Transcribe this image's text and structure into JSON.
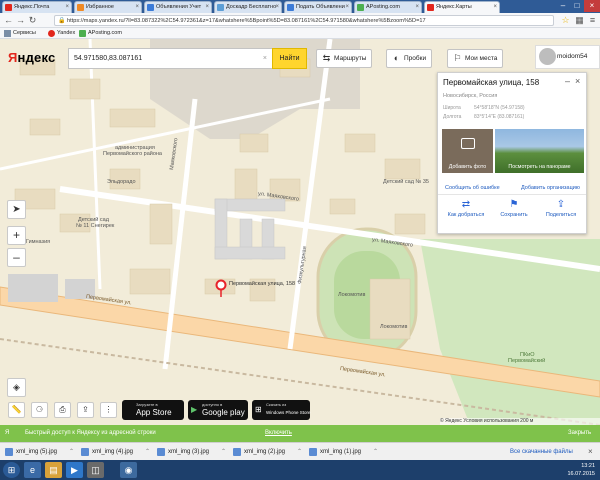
{
  "browser": {
    "tabs": [
      {
        "label": "Яндекс.Почта",
        "color": "#e2261c"
      },
      {
        "label": "Избранное",
        "color": "#f08a24"
      },
      {
        "label": "Объявления Учет",
        "color": "#3b7bd8"
      },
      {
        "label": "Доскадр Бесплатно",
        "color": "#5c9ed6"
      },
      {
        "label": "Подать Объявлени",
        "color": "#3b7bd8"
      },
      {
        "label": "APosting.com",
        "color": "#4caf50"
      },
      {
        "label": "Яндекс.Карты",
        "color": "#e2261c"
      }
    ],
    "url": "https://maps.yandex.ru/?ll=83.087322%2C54.972361&z=17&whatshere%5Bpoint%5D=83.087161%2C54.971580&whatshere%5Bzoom%5D=17",
    "bookmarks": [
      {
        "label": "Сервисы"
      },
      {
        "label": "Yandex"
      },
      {
        "label": "APosting.com"
      }
    ]
  },
  "yandex": {
    "logo_part1": "Я",
    "logo_part2": "ндекс",
    "search_value": "54.971580,83.087161",
    "find_label": "Найти",
    "routes_label": "Маршруты",
    "traffic_label": "Пробки",
    "places_label": "Мои места",
    "user_name": "moidom54"
  },
  "card": {
    "title": "Первомайская улица, 158",
    "subtitle": "Новосибирск, Россия",
    "lat_label": "Широта",
    "lat_value": "54°58'18\"N (54.97158)",
    "lon_label": "Долгота",
    "lon_value": "83°5'14\"E (83.087161)",
    "add_photo": "Добавить фото",
    "view_panorama": "Посмотреть на панораме",
    "report_error": "Сообщить об ошибке",
    "add_org": "Добавить организацию",
    "actions": [
      {
        "label": "Как добраться",
        "icon": "directions-icon"
      },
      {
        "label": "Сохранить",
        "icon": "bookmark-icon"
      },
      {
        "label": "Поделиться",
        "icon": "share-icon"
      }
    ]
  },
  "map": {
    "labels": [
      {
        "text": "администрация",
        "name": "label-administration"
      },
      {
        "text": "Первомайского района",
        "name": "label-district"
      },
      {
        "text": "Эльдорадо",
        "name": "label-eldorado"
      },
      {
        "text": "Детский сад",
        "name": "label-kindergarten"
      },
      {
        "text": "№ 11 Снегирек",
        "name": "label-kindergarten-name"
      },
      {
        "text": "Гимназия",
        "name": "label-gymnasium"
      },
      {
        "text": "ул. Маяковского",
        "name": "label-mayakovsky-1"
      },
      {
        "text": "ул. Маяковского",
        "name": "label-mayakovsky-2"
      },
      {
        "text": "Маяковского",
        "name": "label-mayakovsky-vert"
      },
      {
        "text": "Физкультурная",
        "name": "label-fizkult"
      },
      {
        "text": "Детский сад № 35",
        "name": "label-kindergarten-35"
      },
      {
        "text": "Первомайская улица, 158",
        "name": "label-marker-address"
      },
      {
        "text": "Локомотив",
        "name": "label-lokomotiv-1"
      },
      {
        "text": "Локомотив",
        "name": "label-lokomotiv-2"
      },
      {
        "text": "Первомайская ул.",
        "name": "label-pervomayskaya-1"
      },
      {
        "text": "Первомайская ул.",
        "name": "label-pervomayskaya-2"
      },
      {
        "text": "ПКиО",
        "name": "label-park"
      },
      {
        "text": "Первомайский",
        "name": "label-park-name"
      }
    ]
  },
  "stores": {
    "appstore_small": "Загрузите в",
    "appstore_big": "App Store",
    "googleplay_small": "доступно в",
    "googleplay_big": "Google play",
    "windows_small": "Скачать из",
    "windows_big": "Windows Phone Store"
  },
  "copyright": "© Яндекс  Условия использования  200 м",
  "green_bar": {
    "text": "Быстрый доступ к Яндексу из адресной строки",
    "install": "Включить",
    "close": "Закрыть"
  },
  "downloads": [
    {
      "label": "xml_img (5).jpg"
    },
    {
      "label": "xml_img (4).jpg"
    },
    {
      "label": "xml_img (3).jpg"
    },
    {
      "label": "xml_img (2).jpg"
    },
    {
      "label": "xml_img (1).jpg"
    }
  ],
  "downloads_all": "Все скачанные файлы",
  "taskbar": {
    "time": "13:21",
    "date": "16.07.2015"
  }
}
